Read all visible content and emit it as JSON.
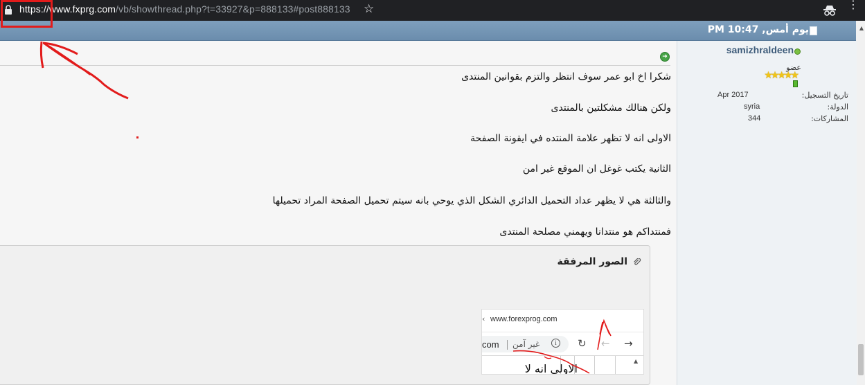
{
  "browser": {
    "url_protocol": "https://",
    "url_domain": "www.fxprg.com",
    "url_path": "/vb/showthread.php?t=33927&p=888133#post888133",
    "star_glyph": "☆",
    "menu_glyph": "⋮"
  },
  "post": {
    "date": "يوم أمس, 10:47 PM",
    "header_left": "1"
  },
  "user": {
    "username": "samizhraldeen",
    "title": "عضو",
    "stars": "★★★★★",
    "join_label": "تاريخ التسجيل:",
    "join_value": "Apr 2017",
    "country_label": "الدولة:",
    "country_value": "syria",
    "posts_label": "المشاركات:",
    "posts_value": "344"
  },
  "message": {
    "lines": [
      "شكرا اخ ابو عمر سوف انتظر والتزم بقوانين المنتدى",
      "ولكن هنالك مشكلتين بالمنتدى",
      "الاولى انه لا تظهر علامة المنتده في ايقونة الصفحة",
      "الثانية يكتب غوغل ان الموقع غير امن",
      "والثالثة هي لا يظهر عداد التحميل الدائري الشكل الذي يوحي بانه سيتم تحميل الصفحة المراد تحميلها",
      "فمنتداكم هو منتدانا ويهمني مصلحة المنتدى"
    ]
  },
  "attachments": {
    "title": "الصور المرفقة",
    "thumb": {
      "url": "www.forexprog.com",
      "chevron": "‹",
      "com_text": "com",
      "insecure": "غير آمن",
      "info_glyph": "i",
      "reload_glyph": "↻",
      "back_glyph": "←",
      "forward_glyph": "→",
      "big_text": "الاولى انه لا",
      "scroll_up": "▲"
    }
  },
  "colors": {
    "header_bar": "#6b8dad",
    "annotation_red": "#e21b1b"
  }
}
